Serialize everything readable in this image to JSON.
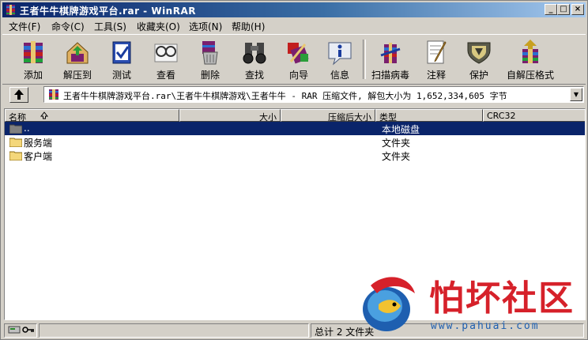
{
  "window": {
    "title": "王者牛牛棋牌游戏平台.rar - WinRAR",
    "min_glyph": "_",
    "max_glyph": "□",
    "close_glyph": "×"
  },
  "menu": {
    "items": [
      "文件(F)",
      "命令(C)",
      "工具(S)",
      "收藏夹(O)",
      "选项(N)",
      "帮助(H)"
    ]
  },
  "toolbar": {
    "buttons": [
      {
        "label": "添加",
        "icon": "add-archive-icon"
      },
      {
        "label": "解压到",
        "icon": "extract-to-icon"
      },
      {
        "label": "测试",
        "icon": "test-icon"
      },
      {
        "label": "查看",
        "icon": "view-icon"
      },
      {
        "label": "删除",
        "icon": "delete-icon"
      },
      {
        "label": "查找",
        "icon": "find-icon"
      },
      {
        "label": "向导",
        "icon": "wizard-icon"
      },
      {
        "label": "信息",
        "icon": "info-icon"
      },
      {
        "label": "扫描病毒",
        "icon": "virus-scan-icon"
      },
      {
        "label": "注释",
        "icon": "comment-icon"
      },
      {
        "label": "保护",
        "icon": "protect-icon"
      },
      {
        "label": "自解压格式",
        "icon": "sfx-icon"
      }
    ]
  },
  "address": {
    "path": "王者牛牛棋牌游戏平台.rar\\王者牛牛棋牌游戏\\王者牛牛 - RAR 压缩文件, 解包大小为 1,652,334,605 字节",
    "dropdown_glyph": "▼"
  },
  "columns": {
    "name": "名称",
    "size": "大小",
    "packed": "压缩后大小",
    "type": "类型",
    "crc": "CRC32"
  },
  "files": [
    {
      "name": "..",
      "type": "本地磁盘",
      "selected": true
    },
    {
      "name": "服务端",
      "type": "文件夹",
      "selected": false
    },
    {
      "name": "客户端",
      "type": "文件夹",
      "selected": false
    }
  ],
  "status": {
    "summary": "总计 2 文件夹"
  },
  "watermark": {
    "text": "怕坏社区",
    "url": "www.pahuai.com"
  },
  "colors": {
    "title_active": "#0a246a",
    "selection": "#0a246a",
    "face": "#d4d0c8",
    "watermark_red": "#d6212a",
    "watermark_blue": "#1e5fb0"
  }
}
